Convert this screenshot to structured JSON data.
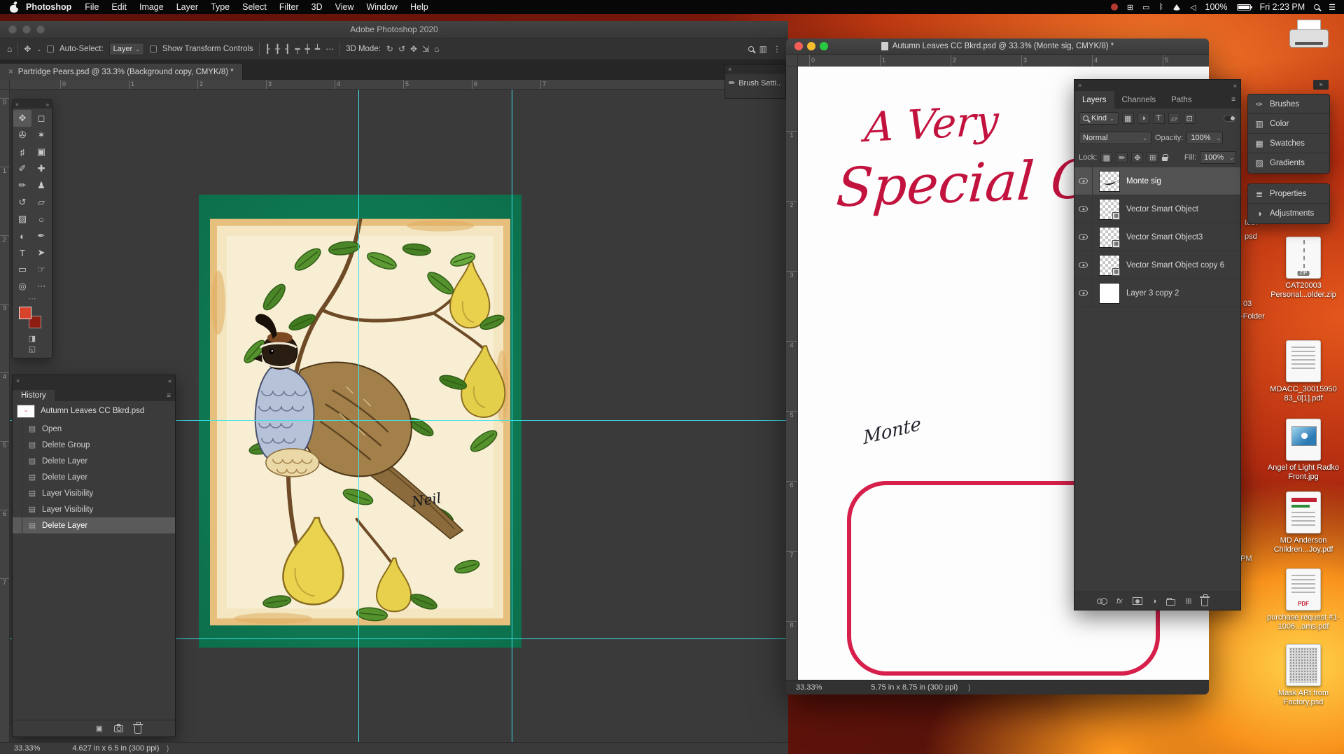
{
  "colors": {
    "guide": "#3be3ea",
    "frame_red": "#d6204b",
    "script_red": "#c2123e",
    "mat_green": "#0e7b54"
  },
  "menubar": {
    "app_name": "Photoshop",
    "items": [
      "File",
      "Edit",
      "Image",
      "Layer",
      "Type",
      "Select",
      "Filter",
      "3D",
      "View",
      "Window",
      "Help"
    ],
    "battery_percent": "100%",
    "clock": "Fri 2:23 PM",
    "glyphs": {
      "grid": "⊞",
      "display": "▭",
      "bluetooth": "ᛒ",
      "volume": "◁",
      "list": "☰"
    }
  },
  "main_window": {
    "title": "Adobe Photoshop 2020",
    "doc_tab": "Partridge Pears.psd @ 33.3% (Background copy, CMYK/8) *",
    "options": {
      "home_glyph": "⌂",
      "move_glyph": "✥",
      "auto_select_label": "Auto-Select:",
      "auto_select_value": "Layer",
      "show_transform_label": "Show Transform Controls",
      "align_glyphs": [
        "┠",
        "╂",
        "┨",
        "┯",
        "┿",
        "┷"
      ],
      "more_glyph": "⋯",
      "mode_3d_label": "3D Mode:",
      "mode_3d_glyphs": [
        "↻",
        "↺",
        "✥",
        "⇲",
        "⌂"
      ]
    },
    "ruler_h": [
      "0",
      "1",
      "2",
      "3",
      "4",
      "5",
      "6",
      "7"
    ],
    "ruler_v": [
      "0",
      "1",
      "2",
      "3",
      "4",
      "5",
      "6",
      "7"
    ],
    "status_zoom": "33.33%",
    "status_dims": "4.627 in x 6.5 in (300 ppi)",
    "artwork_signature": "Neil"
  },
  "tools": [
    {
      "n": "move-tool",
      "g": "✥"
    },
    {
      "n": "marquee-tool",
      "g": "◻"
    },
    {
      "n": "lasso-tool",
      "g": "✇"
    },
    {
      "n": "quick-selection-tool",
      "g": "✶"
    },
    {
      "n": "crop-tool",
      "g": "♯"
    },
    {
      "n": "frame-tool",
      "g": "▣"
    },
    {
      "n": "eyedropper-tool",
      "g": "✐"
    },
    {
      "n": "healing-brush-tool",
      "g": "✚"
    },
    {
      "n": "brush-tool",
      "g": "✏"
    },
    {
      "n": "clone-stamp-tool",
      "g": "♟"
    },
    {
      "n": "history-brush-tool",
      "g": "↺"
    },
    {
      "n": "eraser-tool",
      "g": "▱"
    },
    {
      "n": "gradient-tool",
      "g": "▨"
    },
    {
      "n": "blur-tool",
      "g": "○"
    },
    {
      "n": "dodge-tool",
      "g": "◐"
    },
    {
      "n": "pen-tool",
      "g": "✒"
    },
    {
      "n": "type-tool",
      "g": "T"
    },
    {
      "n": "path-selection-tool",
      "g": "➤"
    },
    {
      "n": "shape-tool",
      "g": "▭"
    },
    {
      "n": "hand-tool",
      "g": "☞"
    },
    {
      "n": "zoom-tool",
      "g": "◎"
    },
    {
      "n": "edit-toolbar",
      "g": "⋯"
    }
  ],
  "history_panel": {
    "title": "History",
    "snapshot_name": "Autumn Leaves CC Bkrd.psd",
    "states": [
      "Open",
      "Delete Group",
      "Delete Layer",
      "Delete Layer",
      "Layer Visibility",
      "Layer Visibility",
      "Delete Layer"
    ]
  },
  "doc2_window": {
    "title": "Autumn Leaves CC Bkrd.psd @ 33.3% (Monte sig, CMYK/8) *",
    "ruler_h": [
      "0",
      "1",
      "2",
      "3",
      "4",
      "5"
    ],
    "ruler_v": [
      "1",
      "2",
      "3",
      "4",
      "5",
      "6",
      "7",
      "8"
    ],
    "status_zoom": "33.33%",
    "status_dims": "5.75 in x 8.75 in (300 ppi)",
    "card_text_line1": "A Very",
    "card_text_line2": "Special G",
    "signature": "Monte"
  },
  "layers_panel": {
    "tabs": [
      "Layers",
      "Channels",
      "Paths"
    ],
    "kind_label": "Kind",
    "filter_glyphs": [
      "▦",
      "◑",
      "T",
      "▱",
      "⊡"
    ],
    "blend_mode": "Normal",
    "opacity_label": "Opacity:",
    "opacity_value": "100%",
    "lock_label": "Lock:",
    "lock_glyphs": [
      "▦",
      "✏",
      "✥",
      "⊞"
    ],
    "fill_label": "Fill:",
    "fill_value": "100%",
    "fx_label": "fx",
    "new_layer_glyph": "⊞",
    "adjust_glyph": "◑",
    "layers": [
      {
        "name": "Monte sig"
      },
      {
        "name": "Vector Smart Object"
      },
      {
        "name": "Vector Smart Object3"
      },
      {
        "name": "Vector Smart Object copy 6"
      },
      {
        "name": "Layer 3 copy 2"
      }
    ]
  },
  "dock_group1": [
    {
      "btn": "panel-button-brushes",
      "icon_name": "brushes-icon",
      "icon": "✑",
      "label": "Brushes"
    },
    {
      "btn": "panel-button-color",
      "icon_name": "color-icon",
      "icon": "▥",
      "label": "Color"
    },
    {
      "btn": "panel-button-swatches",
      "icon_name": "swatches-icon",
      "icon": "▦",
      "label": "Swatches"
    },
    {
      "btn": "panel-button-gradients",
      "icon_name": "gradients-icon",
      "icon": "▨",
      "label": "Gradients"
    }
  ],
  "dock_group2": [
    {
      "btn": "panel-button-properties",
      "icon_name": "properties-icon",
      "icon": "≣",
      "label": "Properties"
    },
    {
      "btn": "panel-button-adjustments",
      "icon_name": "adjustments-icon",
      "icon": "◑",
      "label": "Adjustments"
    }
  ],
  "brush_settings_label": "Brush Setti..",
  "desktop": {
    "icons": [
      {
        "label": "CAT20003 Personal...older.zip"
      },
      {
        "label": "MDACC_30015950 83_0[1].pdf"
      },
      {
        "label": "Angel of Light Radko Front.jpg"
      },
      {
        "label": "MD Anderson Children...Joy.pdf"
      },
      {
        "label": "purchase request #1-1006...ams.pdf"
      },
      {
        "label": "Mask ARt from Factory.psd"
      }
    ],
    "zip_badge": "ZIP",
    "pdf_badge": "PDF",
    "fragments": [
      "teer",
      "psd",
      "03",
      "-Folder",
      "PM"
    ]
  }
}
